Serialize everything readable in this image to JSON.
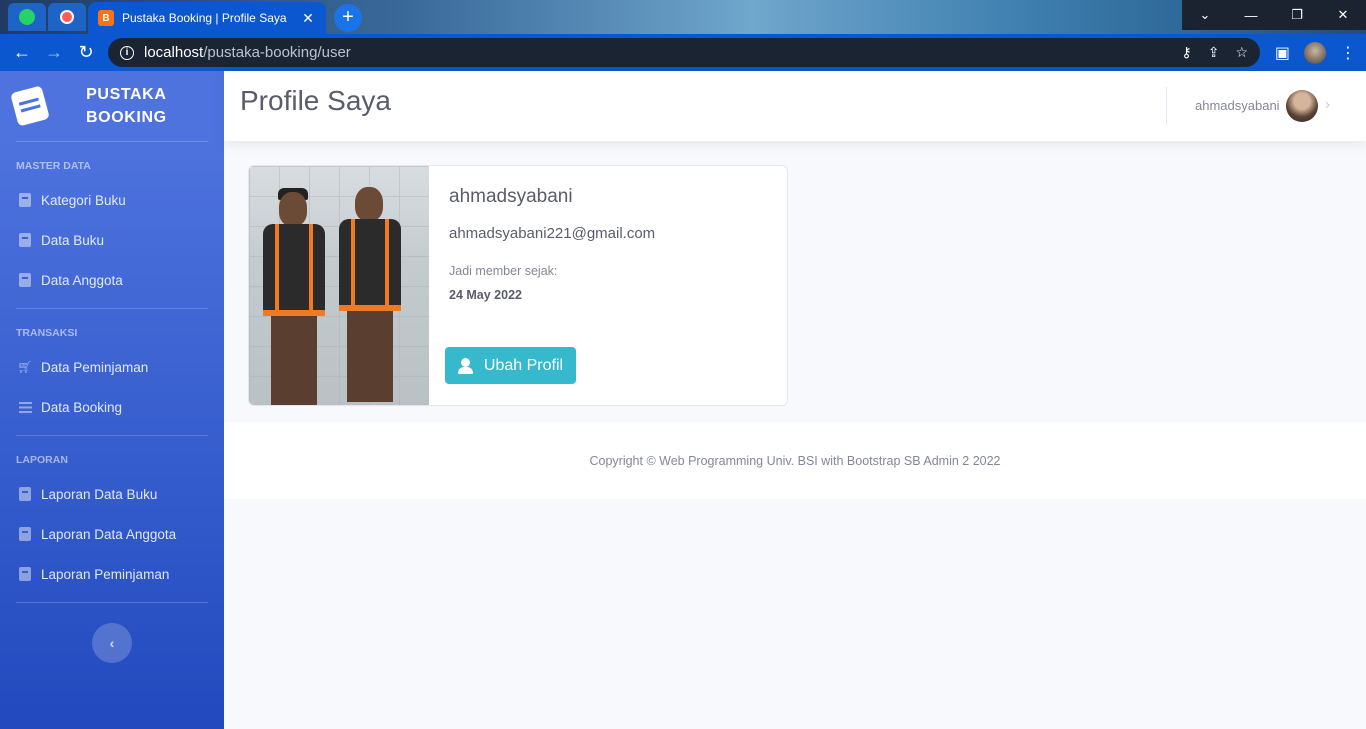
{
  "browser": {
    "tab_title": "Pustaka Booking | Profile Saya",
    "favicon_text": "B",
    "url_host": "localhost",
    "url_path": "/pustaka-booking/user"
  },
  "sidebar": {
    "brand_line1": "PUSTAKA",
    "brand_line2": "BOOKING",
    "sections": [
      {
        "heading": "MASTER DATA",
        "items": [
          {
            "label": "Kategori Buku",
            "icon": "book-icon"
          },
          {
            "label": "Data Buku",
            "icon": "book-icon"
          },
          {
            "label": "Data Anggota",
            "icon": "book-icon"
          }
        ]
      },
      {
        "heading": "TRANSAKSI",
        "items": [
          {
            "label": "Data Peminjaman",
            "icon": "cart-icon"
          },
          {
            "label": "Data Booking",
            "icon": "list-icon"
          }
        ]
      },
      {
        "heading": "LAPORAN",
        "items": [
          {
            "label": "Laporan Data Buku",
            "icon": "address-book-icon"
          },
          {
            "label": "Laporan Data Anggota",
            "icon": "address-book-icon"
          },
          {
            "label": "Laporan Peminjaman",
            "icon": "address-book-icon"
          }
        ]
      }
    ],
    "toggle_icon": "‹"
  },
  "topbar": {
    "page_title": "Profile Saya",
    "user_name": "ahmadsyabani"
  },
  "profile": {
    "name": "ahmadsyabani",
    "email": "ahmadsyabani221@gmail.com",
    "member_since_label": "Jadi member sejak:",
    "member_since_date": "24 May 2022",
    "edit_button_label": "Ubah Profil"
  },
  "footer": {
    "copyright": "Copyright © Web Programming Univ. BSI with Bootstrap SB Admin 2 2022"
  },
  "colors": {
    "sidebar_top": "#4e73df",
    "sidebar_bottom": "#224abe",
    "button_info": "#36b9cc",
    "browser_accent": "#0b57d0"
  }
}
